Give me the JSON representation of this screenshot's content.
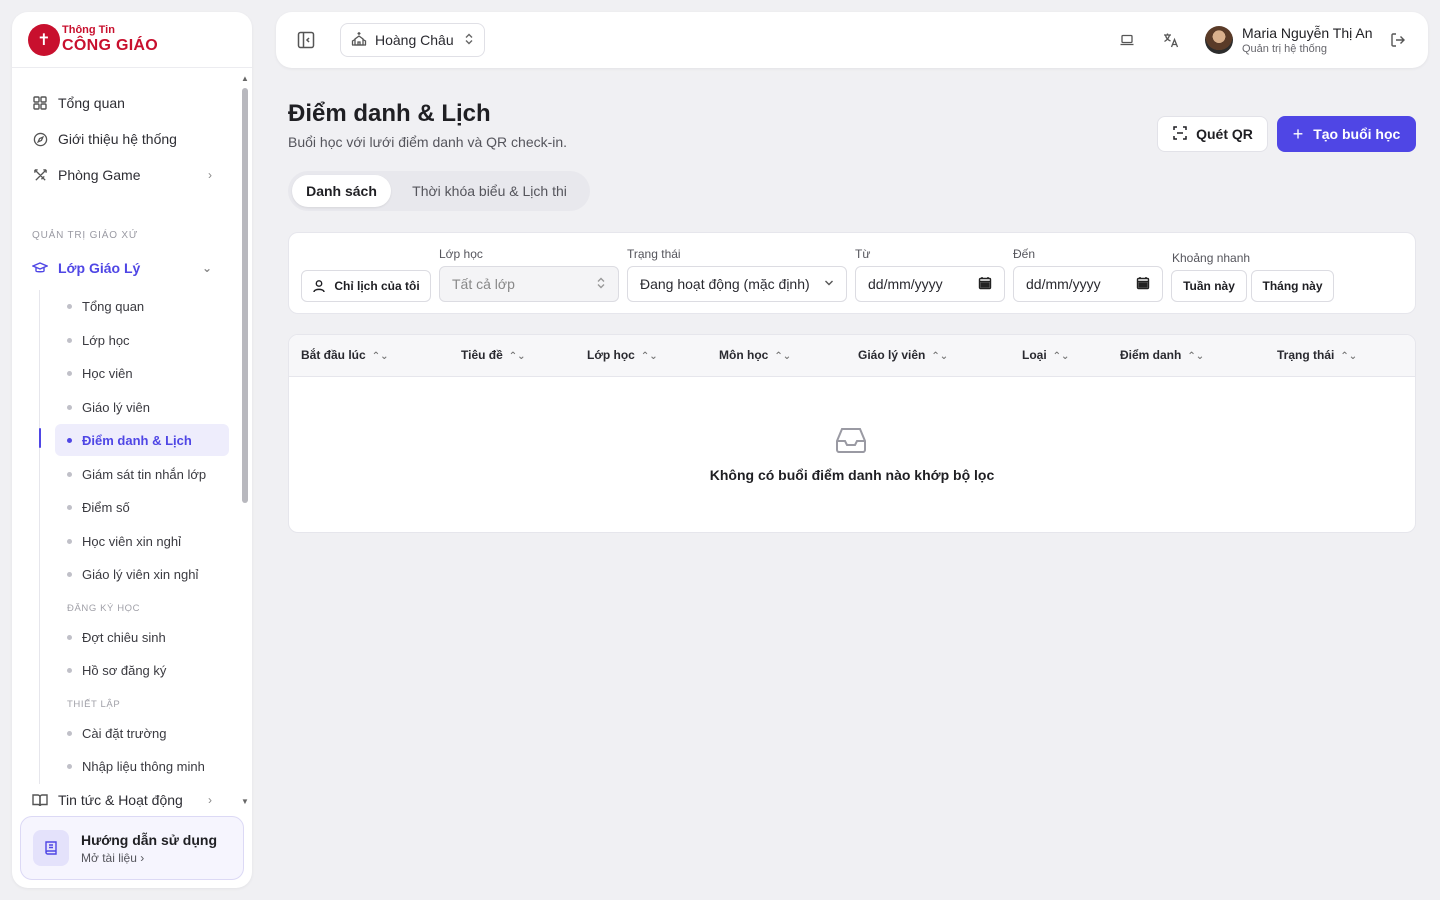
{
  "brand": {
    "top": "Thông Tin",
    "bottom": "CÔNG GIÁO",
    "color": "#c8102e"
  },
  "sidebar": {
    "items": [
      {
        "label": "Tổng quan",
        "icon": "grid-icon"
      },
      {
        "label": "Giới thiệu hệ thống",
        "icon": "compass-icon"
      },
      {
        "label": "Phòng Game",
        "icon": "swords-icon"
      }
    ],
    "section": "QUẢN TRỊ GIÁO XỨ",
    "group": {
      "label": "Lớp Giáo Lý",
      "icon": "graduation-cap-icon"
    },
    "sub_items": [
      "Tổng quan",
      "Lớp học",
      "Học viên",
      "Giáo lý viên",
      "Điểm danh & Lịch",
      "Giám sát tin nhắn lớp",
      "Điểm số",
      "Học viên xin nghỉ",
      "Giáo lý viên xin nghỉ"
    ],
    "sub_section_registration": "ĐĂNG KÝ HỌC",
    "registration_items": [
      "Đợt chiêu sinh",
      "Hồ sơ đăng ký"
    ],
    "sub_section_setup": "THIẾT LẬP",
    "setup_items": [
      "Cài đặt trường",
      "Nhập liệu thông minh"
    ],
    "news": {
      "label": "Tin tức & Hoạt động",
      "icon": "book-open-icon"
    },
    "guide": {
      "title": "Hướng dẫn sử dụng",
      "subtitle": "Mở tài liệu ›"
    }
  },
  "topbar": {
    "parish": "Hoàng Châu",
    "user_name": "Maria Nguyễn Thị An",
    "user_role": "Quản trị hệ thống"
  },
  "page": {
    "title": "Điểm danh & Lịch",
    "subtitle": "Buổi học với lưới điểm danh và QR check-in.",
    "btn_qr": "Quét QR",
    "btn_create": "Tạo buổi học",
    "accent": "#4f46e5"
  },
  "tabs": [
    "Danh sách",
    "Thời khóa biểu & Lịch thi"
  ],
  "filters": {
    "my_schedule": "Chỉ lịch của tôi",
    "class_label": "Lớp học",
    "class_value": "Tất cả lớp",
    "status_label": "Trạng thái",
    "status_value": "Đang hoạt động (mặc định)",
    "from_label": "Từ",
    "from_placeholder": "dd/mm/yyyy",
    "to_label": "Đến",
    "to_placeholder": "dd/mm/yyyy",
    "quick_label": "Khoảng nhanh",
    "quick_week": "Tuần này",
    "quick_month": "Tháng này"
  },
  "table": {
    "columns": [
      "Bắt đầu lúc",
      "Tiêu đề",
      "Lớp học",
      "Môn học",
      "Giáo lý viên",
      "Loại",
      "Điểm danh",
      "Trạng thái"
    ],
    "empty_text": "Không có buổi điểm danh nào khớp bộ lọc"
  }
}
